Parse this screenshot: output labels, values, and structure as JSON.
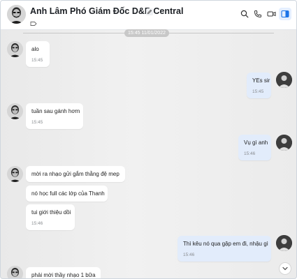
{
  "header": {
    "title": "Anh Lâm Phó Giám Đốc D&B Central"
  },
  "date_divider": "15:45 11/01/2022",
  "messages": [
    {
      "text": "alo",
      "time": "15:45"
    },
    {
      "text": "YEs sir",
      "time": "15:45"
    },
    {
      "text": "tuần sau gánh hơm",
      "time": "15:45"
    },
    {
      "text": "Vụ gì anh",
      "time": "15:46"
    },
    {
      "text": "mời ra nhạo gửi gắm thằng đệ mep"
    },
    {
      "text": "nó học full các lớp của Thanh"
    },
    {
      "text": "tui giới thiệu dồi",
      "time": "15:46"
    },
    {
      "text": "Thì kêu nó qua gặp em đi, nhậu gì",
      "time": "15:46"
    },
    {
      "text": "phải mời thầy nhạo 1 bữa"
    }
  ],
  "colors": {
    "incoming_bubble": "#ffffff",
    "outgoing_bubble": "#e2ecfb",
    "accent": "#1a73e8"
  },
  "icons": [
    "edit-icon",
    "tag-icon",
    "search-icon",
    "phone-icon",
    "video-icon",
    "sidebar-toggle-icon",
    "chevron-down-icon"
  ]
}
